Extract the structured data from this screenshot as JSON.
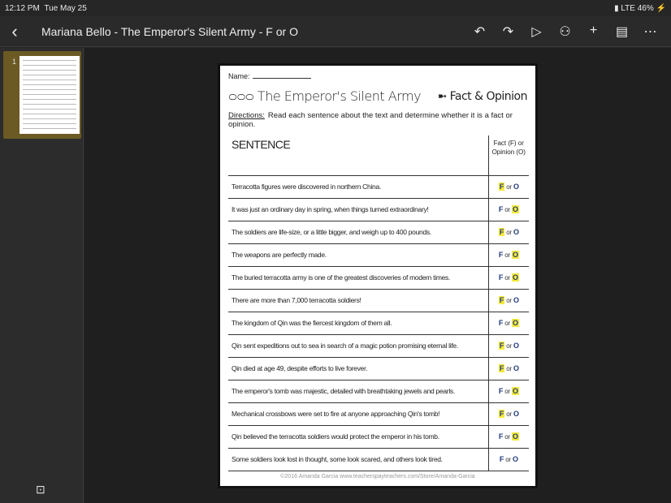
{
  "status": {
    "time": "12:12 PM",
    "date": "Tue May 25",
    "network": "LTE",
    "battery": "46%"
  },
  "toolbar": {
    "title": "Mariana Bello - The Emperor's Silent Army - F or O"
  },
  "sidebar": {
    "slide_number": "1"
  },
  "doc": {
    "name_label": "Name:",
    "title": "The Emperor's Silent Army",
    "subtitle": "Fact & Opinion",
    "directions_label": "Directions:",
    "directions": "Read each sentence about the text and determine whether it is a fact or opinion.",
    "col_sentence": "SENTENCE",
    "col_answer": "Fact (F) or Opinion (O)",
    "rows": [
      {
        "s": "Terracotta figures were discovered in northern China.",
        "hl": "F"
      },
      {
        "s": "It was just an ordinary day in spring, when things turned extraordinary!",
        "hl": "O"
      },
      {
        "s": "The soldiers are life-size, or a little bigger, and weigh up to 400 pounds.",
        "hl": "F"
      },
      {
        "s": "The weapons are perfectly made.",
        "hl": "O"
      },
      {
        "s": "The buried terracotta army is one of the greatest discoveries of modern times.",
        "hl": "O"
      },
      {
        "s": "There are more than 7,000 terracotta soldiers!",
        "hl": "F"
      },
      {
        "s": "The kingdom of Qin was the fiercest kingdom of them all.",
        "hl": "O"
      },
      {
        "s": "Qin sent expeditions out to sea in search of a magic potion promising eternal life.",
        "hl": "F"
      },
      {
        "s": "Qin died at age 49, despite efforts to live forever.",
        "hl": "F"
      },
      {
        "s": "The emperor's tomb was majestic, detailed with breathtaking jewels and pearls.",
        "hl": "O"
      },
      {
        "s": "Mechanical crossbows were set to fire at anyone approaching Qin's tomb!",
        "hl": "F"
      },
      {
        "s": "Qin believed the terracotta soldiers would protect the emperor in his tomb.",
        "hl": "O"
      },
      {
        "s": "Some soldiers look lost in thought, some look scared, and others look tired.",
        "hl": ""
      }
    ],
    "answer": {
      "f": "F",
      "or": "or",
      "o": "O"
    },
    "footer": "©2016 Amanda Garcia www.teacherspayteachers.com/Store/Amanda-Garcia"
  }
}
